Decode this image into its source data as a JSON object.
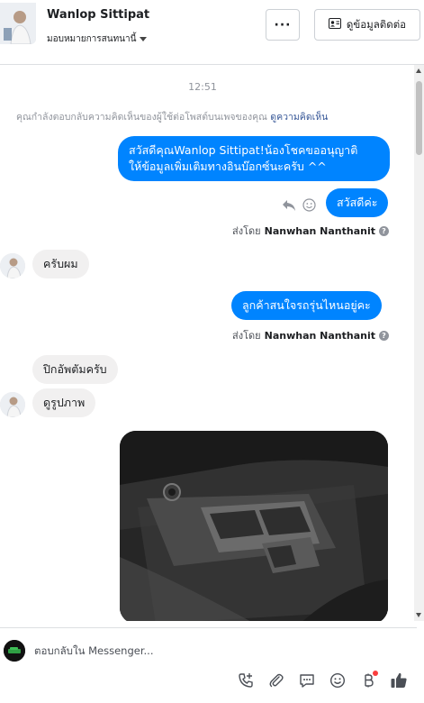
{
  "header": {
    "contact_name": "Wanlop Sittipat",
    "assign_label": "มอบหมายการสนทนานี้",
    "more_label": "···",
    "view_contact_label": "ดูข้อมูลติดต่อ"
  },
  "conversation": {
    "timestamp": "12:51",
    "notice_text": "คุณกำลังตอบกลับความคิดเห็นของผู้ใช้ต่อโพสต์บนเพจของคุณ",
    "notice_link": "ดูความคิดเห็น",
    "messages": [
      {
        "direction": "out",
        "text_line1": "สวัสดีคุณWanlop Sittipat!น้องโชคขออนุญาติ",
        "text_line2": "ให้ข้อมูลเพิ่มเติมทางอินบ๊อกซ์นะครับ ^^"
      },
      {
        "direction": "out",
        "text": "สวัสดีค่ะ"
      },
      {
        "direction": "in",
        "text": "ครับผม"
      },
      {
        "direction": "out",
        "text": "ลูกค้าสนใจรถรุ่นไหนอยู่คะ"
      },
      {
        "direction": "in",
        "text": "ปิกอัพตัมครับ"
      },
      {
        "direction": "in",
        "text": "ดูรูปภาพ"
      }
    ],
    "sent_by_prefix": "ส่งโดย",
    "sent_by_name": "Nanwhan Nanthanit"
  },
  "composer": {
    "placeholder": "ตอบกลับใน Messenger...",
    "tools": [
      "add-call-icon",
      "attachment-icon",
      "saved-reply-icon",
      "emoji-icon",
      "baht-payment-icon",
      "like-icon"
    ]
  },
  "colors": {
    "outgoing_bubble": "#0084ff",
    "incoming_bubble": "#f1f0f0",
    "link": "#385898",
    "notification_dot": "#fa3e3e"
  }
}
